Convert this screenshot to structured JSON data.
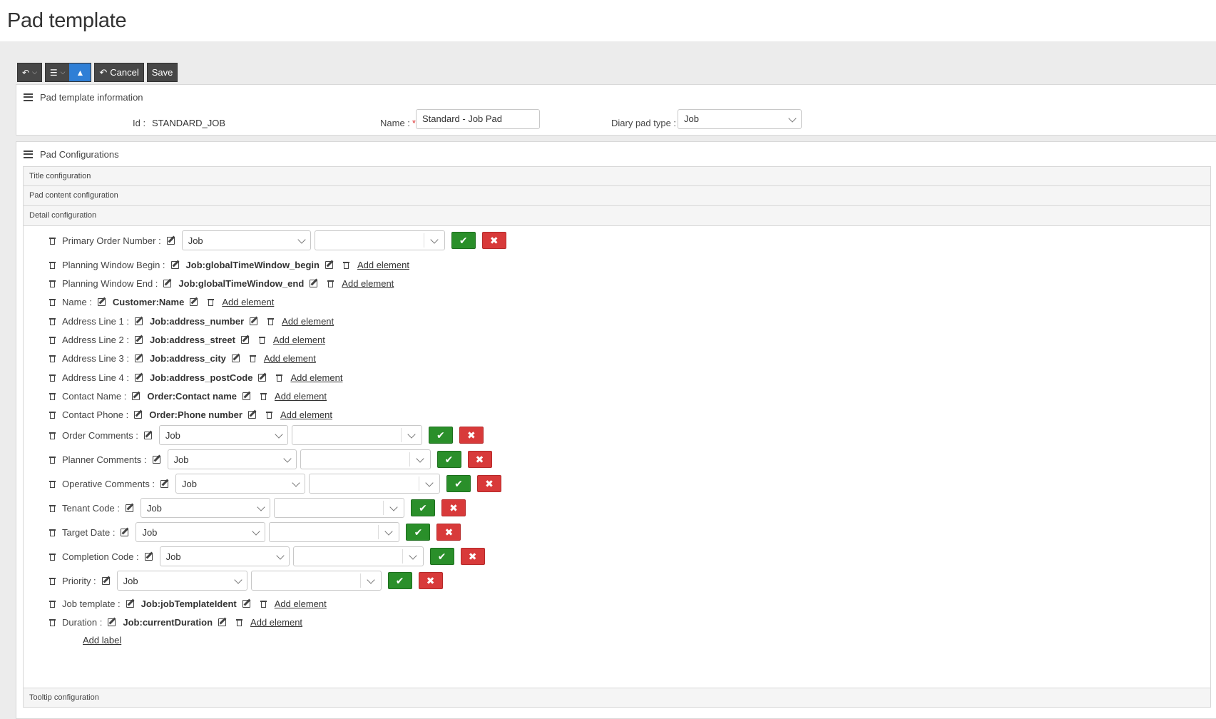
{
  "page_title": "Pad template",
  "toolbar": {
    "cancel_label": "Cancel",
    "save_label": "Save"
  },
  "info_panel": {
    "title": "Pad template information",
    "id_label": "Id :",
    "id_value": "STANDARD_JOB",
    "name_label": "Name :",
    "name_required": "*",
    "name_value": "Standard - Job Pad",
    "diary_label": "Diary pad type :",
    "diary_value": "Job"
  },
  "config_panel": {
    "title": "Pad Configurations",
    "sections": [
      "Title configuration",
      "Pad content configuration",
      "Detail configuration"
    ],
    "footer_section": "Tooltip configuration",
    "add_label": "Add label"
  },
  "rows": [
    {
      "label": "Primary Order Number :",
      "type": "select",
      "value": "Job"
    },
    {
      "label": "Planning Window Begin :",
      "type": "value",
      "value": "Job:globalTimeWindow_begin",
      "link": "Add element"
    },
    {
      "label": "Planning Window End :",
      "type": "value",
      "value": "Job:globalTimeWindow_end",
      "link": "Add element"
    },
    {
      "label": "Name :",
      "type": "value",
      "value": "Customer:Name",
      "link": "Add element"
    },
    {
      "label": "Address Line 1 :",
      "type": "value",
      "value": "Job:address_number",
      "link": "Add element"
    },
    {
      "label": "Address Line 2 :",
      "type": "value",
      "value": "Job:address_street",
      "link": "Add element"
    },
    {
      "label": "Address Line 3 :",
      "type": "value",
      "value": "Job:address_city",
      "link": "Add element"
    },
    {
      "label": "Address Line 4 :",
      "type": "value",
      "value": "Job:address_postCode",
      "link": "Add element"
    },
    {
      "label": "Contact Name :",
      "type": "value",
      "value": "Order:Contact name",
      "link": "Add element"
    },
    {
      "label": "Contact Phone :",
      "type": "value",
      "value": "Order:Phone number",
      "link": "Add element"
    },
    {
      "label": "Order Comments :",
      "type": "select",
      "value": "Job"
    },
    {
      "label": "Planner Comments :",
      "type": "select",
      "value": "Job"
    },
    {
      "label": "Operative Comments :",
      "type": "select",
      "value": "Job"
    },
    {
      "label": "Tenant Code :",
      "type": "select",
      "value": "Job"
    },
    {
      "label": "Target Date :",
      "type": "select",
      "value": "Job"
    },
    {
      "label": "Completion Code :",
      "type": "select",
      "value": "Job"
    },
    {
      "label": "Priority :",
      "type": "select",
      "value": "Job"
    },
    {
      "label": "Job template :",
      "type": "value",
      "value": "Job:jobTemplateIdent",
      "link": "Add element"
    },
    {
      "label": "Duration :",
      "type": "value",
      "value": "Job:currentDuration",
      "link": "Add element"
    }
  ]
}
